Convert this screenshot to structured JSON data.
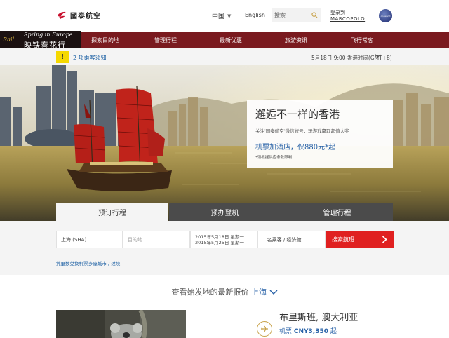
{
  "header": {
    "logo_text": "國泰航空",
    "language": "中国",
    "english_label": "English",
    "search_placeholder": "搜索",
    "login_line1": "登录到",
    "login_line2": "MARCOPOLO",
    "alliance_text": "oneworld"
  },
  "promo_banner": {
    "rail": "Rail",
    "line1": "Spring in Europe",
    "line2": "映铁春花行"
  },
  "nav": {
    "items": [
      {
        "label": "探索目的地"
      },
      {
        "label": "管理行程"
      },
      {
        "label": "最新优惠"
      },
      {
        "label": "旅游资讯"
      },
      {
        "label": "飞行常客"
      }
    ]
  },
  "notice": {
    "flag": "!",
    "text": "2 项乘客须知",
    "time": "5月18日 9:00 香港时间(GMT+8)"
  },
  "hero_card": {
    "title": "邂逅不一样的香港",
    "subtitle": "关注'国泰航空'微信帐号，玩游戏赢取超值大奖",
    "price": "机票加酒店，仅880元*起",
    "note": "*须根据供应条款限制"
  },
  "booking": {
    "tabs": [
      {
        "label": "预订行程"
      },
      {
        "label": "预办登机"
      },
      {
        "label": "管理行程"
      }
    ],
    "from": "上海 (SHA)",
    "to_placeholder": "目的地",
    "date_depart": "2015年5月18日 星期一",
    "date_return": "2015年5月25日 星期一",
    "passengers": "1 名乘客 / 经济舱",
    "search_button": "搜索航班",
    "link_redeem": "凭里数兑换机票",
    "link_multi": "多座城市 / 过境"
  },
  "fares": {
    "heading": "查看始发地的最新报价",
    "city": "上海",
    "deal_title": "布里斯班, 澳大利亚",
    "deal_price_label": "机票",
    "deal_price": "CNY3,350",
    "deal_suffix": "起"
  },
  "colors": {
    "nav_bg": "#7a1a1f",
    "accent_red": "#e02020",
    "link_blue": "#1b5fa3",
    "tab_dark": "#4b4b4b"
  }
}
